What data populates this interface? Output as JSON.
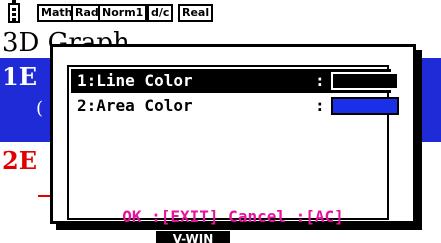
{
  "status_bar": {
    "battery_icon": "battery-icon",
    "tags": [
      "Math",
      "Rad",
      "Norm1",
      "d/c",
      "Real"
    ]
  },
  "background": {
    "title": "3D Graph",
    "row1_index": "1E",
    "row1_sub": "(",
    "row2_index": "2E",
    "function_key": "V-WIN",
    "colors": {
      "row_highlight": "#1e2bd6",
      "row2_text": "#e00000"
    }
  },
  "dialog": {
    "items": [
      {
        "label": "1:Line Color",
        "separator": ":",
        "color": "#000000",
        "selected": true
      },
      {
        "label": "2:Area Color",
        "separator": ":",
        "color": "#1a2fe8",
        "selected": false
      }
    ],
    "footer": "OK :[EXIT] Cancel :[AC]",
    "colors": {
      "footer_text": "#e6139c"
    }
  }
}
